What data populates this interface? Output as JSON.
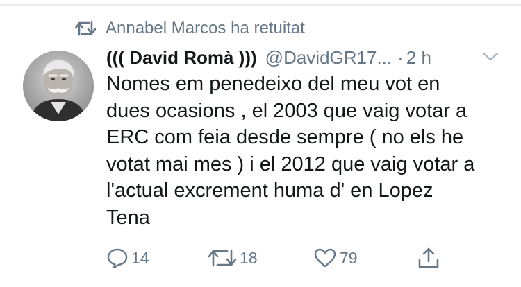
{
  "retweet_banner": {
    "text": "Annabel Marcos ha retuitat",
    "icon": "retweet-icon"
  },
  "tweet": {
    "display_name": "((( David Romà )))",
    "handle": "@DavidGR17...",
    "separator": "·",
    "time": "2 h",
    "text": "Nomes em penedeixo del meu vot en\ndues ocasions , el 2003 que vaig votar a\nERC com feia desde sempre ( no els he\nvotat mai mes ) i el 2012 que vaig votar a\nl'actual excrement huma d' en Lopez\nTena"
  },
  "actions": {
    "reply": {
      "count": "14",
      "icon": "reply-icon"
    },
    "retweet": {
      "count": "18",
      "icon": "retweet-icon"
    },
    "like": {
      "count": "79",
      "icon": "heart-icon"
    },
    "share": {
      "icon": "share-icon"
    }
  },
  "colors": {
    "muted": "#657786",
    "text": "#14171a",
    "border": "#e6ecf0"
  }
}
